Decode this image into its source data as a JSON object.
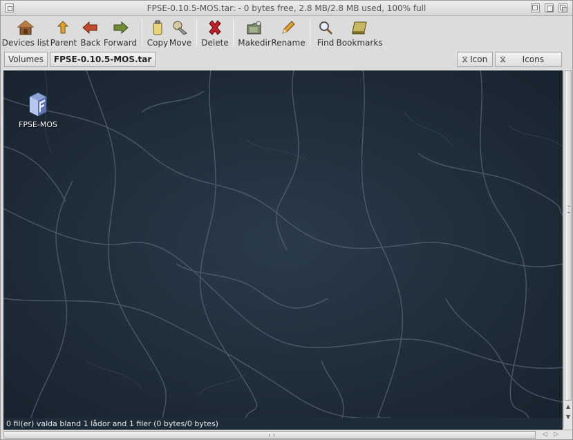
{
  "window": {
    "title": "FPSE-0.10.5-MOS.tar: - 0 bytes free, 2.8 MB/2.8 MB used, 100% full"
  },
  "toolbar": {
    "devices_list": "Devices list",
    "parent": "Parent",
    "back": "Back",
    "forward": "Forward",
    "copy": "Copy",
    "move": "Move",
    "delete": "Delete",
    "makedir": "Makedir",
    "rename": "Rename",
    "find": "Find",
    "bookmarks": "Bookmarks"
  },
  "path": {
    "volumes": "Volumes",
    "current": "FPSE-0.10.5-MOS.tar"
  },
  "view": {
    "mode_label": "Icon",
    "sort_label": "Icons"
  },
  "content": {
    "items": [
      {
        "label": "FPSE-MOS",
        "icon": "drawer-icon"
      }
    ]
  },
  "status": {
    "text": "0 fil(er) valda bland 1 lådor and 1 filer (0 bytes/0 bytes)"
  },
  "colors": {
    "background": "#1e2c39",
    "chrome": "#dcdcdc"
  }
}
